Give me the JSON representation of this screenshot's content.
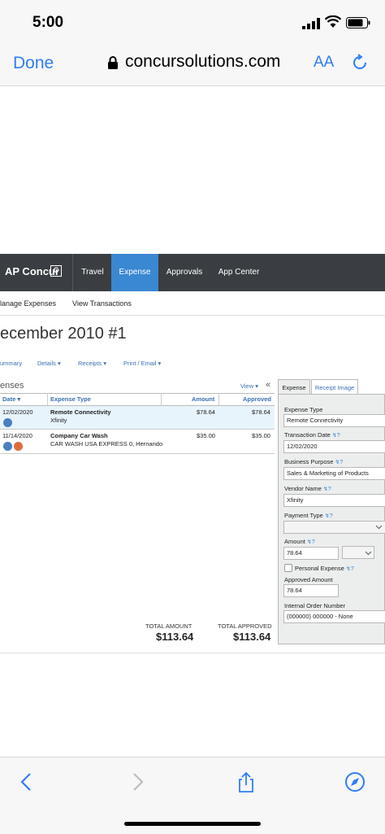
{
  "status_bar": {
    "time": "5:00"
  },
  "browser": {
    "done_label": "Done",
    "url": "concursolutions.com",
    "text_size_label": "AA"
  },
  "app": {
    "brand": "AP Concur",
    "brand_mark": "C",
    "nav": [
      "Travel",
      "Expense",
      "Approvals",
      "App Center"
    ],
    "active_nav": "Expense",
    "subnav": [
      "lanage Expenses",
      "View Transactions"
    ],
    "report_title": "ecember 2010 #1",
    "actions": [
      "ummary",
      "Details ▾",
      "Receipts ▾",
      "Print / Email ▾"
    ]
  },
  "list": {
    "heading": "enses",
    "view_label": "View ▾",
    "collapse_glyph": "«",
    "columns": {
      "date": "Date ▾",
      "type": "Expense Type",
      "amount": "Amount",
      "approved": "Approved"
    },
    "rows": [
      {
        "date": "12/02/2020",
        "type": "Remote Connectivity",
        "vendor": "Xfinity",
        "amount": "$78.64",
        "approved": "$78.64"
      },
      {
        "date": "11/14/2020",
        "type": "Company Car Wash",
        "vendor": "CAR WASH USA EXPRESS 0, Hernando",
        "amount": "$35.00",
        "approved": "$35.00"
      }
    ],
    "totals": {
      "amount_label": "TOTAL AMOUNT",
      "amount": "$113.64",
      "approved_label": "TOTAL APPROVED",
      "approved": "$113.64"
    }
  },
  "panel": {
    "tabs": [
      "Expense",
      "Receipt Image"
    ],
    "hint_glyph": "↯?",
    "fields": {
      "expense_type": {
        "label": "Expense Type",
        "value": "Remote Connectivity"
      },
      "transaction_date": {
        "label": "Transaction Date",
        "value": "12/02/2020"
      },
      "business_purpose": {
        "label": "Business Purpose",
        "value": "Sales & Marketing of Products"
      },
      "vendor_name": {
        "label": "Vendor Name",
        "value": "Xfinity"
      },
      "payment_type": {
        "label": "Payment Type",
        "value": ""
      },
      "amount": {
        "label": "Amount",
        "value": "78.64"
      },
      "personal_expense": {
        "label": "Personal Expense"
      },
      "approved_amount": {
        "label": "Approved Amount",
        "value": "78.64"
      },
      "internal_order": {
        "label": "Internal Order Number",
        "value": "(000000) 000000 - None"
      }
    }
  },
  "colors": {
    "accent": "#3a87d2",
    "nav_bg": "#3a3e42",
    "ios_blue": "#2f7df6",
    "selected_row": "#e8f4fb"
  }
}
